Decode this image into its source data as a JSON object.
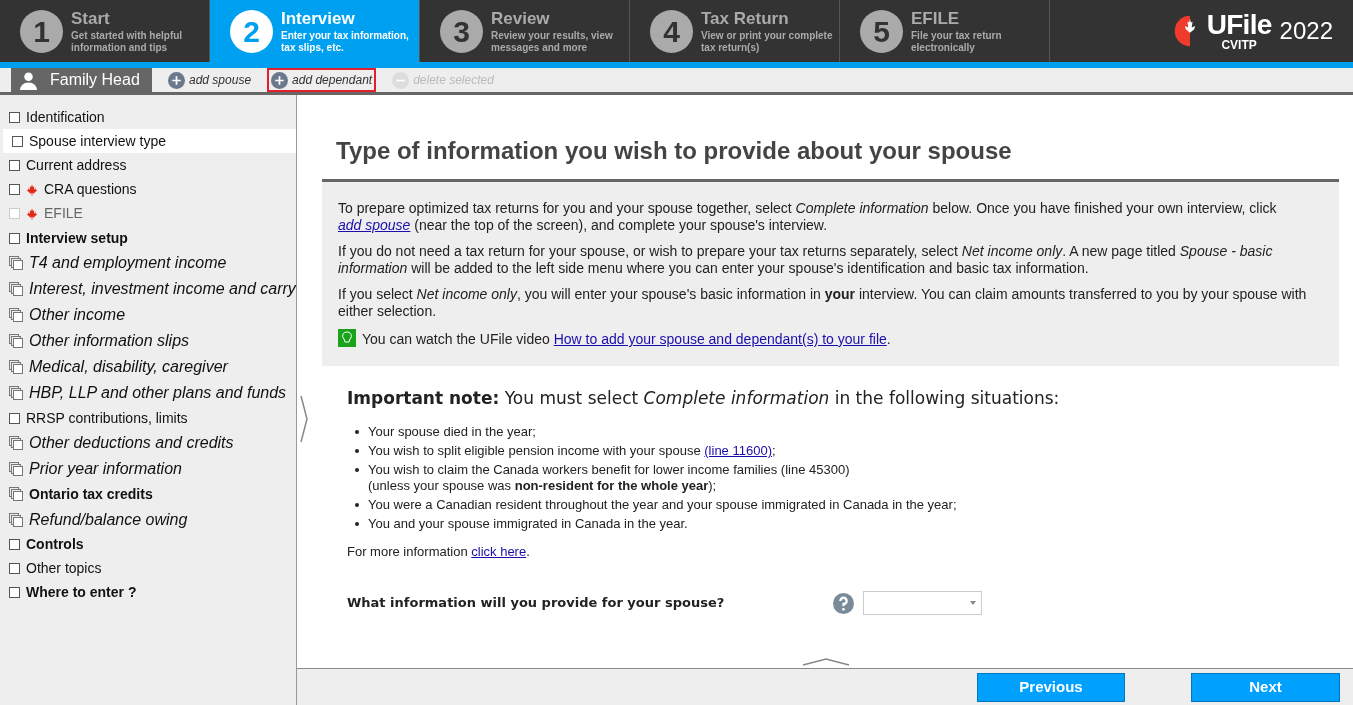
{
  "steps": [
    {
      "number": "1",
      "title": "Start",
      "subtitle": "Get started with helpful information and tips",
      "selected": false
    },
    {
      "number": "2",
      "title": "Interview",
      "subtitle": "Enter your tax information, tax slips, etc.",
      "selected": true
    },
    {
      "number": "3",
      "title": "Review",
      "subtitle": "Review your results, view messages and more",
      "selected": false
    },
    {
      "number": "4",
      "title": "Tax Return",
      "subtitle": "View or print your complete tax return(s)",
      "selected": false
    },
    {
      "number": "5",
      "title": "EFILE",
      "subtitle": "File your tax return electronically",
      "selected": false
    }
  ],
  "logo": {
    "name": "UFile",
    "sub": "CVITP",
    "year": "2022"
  },
  "toolbar": {
    "person_tab": "Family Head",
    "actions": [
      {
        "label": "add spouse",
        "kind": "add",
        "disabled": false,
        "highlighted": false
      },
      {
        "label": "add dependant",
        "kind": "add",
        "disabled": false,
        "highlighted": true
      },
      {
        "label": "delete selected",
        "kind": "delete",
        "disabled": true,
        "highlighted": false
      }
    ]
  },
  "sidebar": {
    "items": [
      {
        "label": "Identification",
        "kind": "page",
        "maple": false,
        "disabled": false,
        "selected": false
      },
      {
        "label": "Spouse interview type",
        "kind": "page",
        "maple": false,
        "disabled": false,
        "selected": true
      },
      {
        "label": "Current address",
        "kind": "page",
        "maple": false,
        "disabled": false,
        "selected": false
      },
      {
        "label": "CRA questions",
        "kind": "page",
        "maple": true,
        "disabled": false,
        "selected": false
      },
      {
        "label": "EFILE",
        "kind": "page",
        "maple": true,
        "disabled": true,
        "selected": false
      },
      {
        "label": "Interview setup",
        "kind": "section",
        "maple": false,
        "disabled": false,
        "selected": false
      },
      {
        "label": "T4 and employment income",
        "kind": "group",
        "maple": false,
        "disabled": false,
        "selected": false
      },
      {
        "label": "Interest, investment income and carry",
        "kind": "group",
        "maple": false,
        "disabled": false,
        "selected": false
      },
      {
        "label": "Other income",
        "kind": "group",
        "maple": false,
        "disabled": false,
        "selected": false
      },
      {
        "label": "Other information slips",
        "kind": "group",
        "maple": false,
        "disabled": false,
        "selected": false
      },
      {
        "label": "Medical, disability, caregiver",
        "kind": "group",
        "maple": false,
        "disabled": false,
        "selected": false
      },
      {
        "label": "HBP, LLP and other plans and funds",
        "kind": "group",
        "maple": false,
        "disabled": false,
        "selected": false
      },
      {
        "label": "RRSP contributions, limits",
        "kind": "page",
        "maple": false,
        "disabled": false,
        "selected": false
      },
      {
        "label": "Other deductions and credits",
        "kind": "group",
        "maple": false,
        "disabled": false,
        "selected": false
      },
      {
        "label": "Prior year information",
        "kind": "group",
        "maple": false,
        "disabled": false,
        "selected": false
      },
      {
        "label": "Ontario tax credits",
        "kind": "province",
        "maple": false,
        "disabled": false,
        "selected": false
      },
      {
        "label": "Refund/balance owing",
        "kind": "group",
        "maple": false,
        "disabled": false,
        "selected": false
      },
      {
        "label": "Controls",
        "kind": "section",
        "maple": false,
        "disabled": false,
        "selected": false
      },
      {
        "label": "Other topics",
        "kind": "page",
        "maple": false,
        "disabled": false,
        "selected": false
      },
      {
        "label": "Where to enter ?",
        "kind": "section",
        "maple": false,
        "disabled": false,
        "selected": false
      }
    ]
  },
  "content": {
    "title": "Type of information you wish to provide about your spouse",
    "info": [
      {
        "parts": [
          {
            "kind": "text",
            "text": "To prepare optimized tax returns for you and your spouse together, select *Complete information* below. Once you have finished your own interview, click "
          },
          {
            "kind": "emlink",
            "text": "add spouse"
          },
          {
            "kind": "text",
            "text": " (near the top of the screen), and complete your spouse's interview."
          }
        ]
      },
      {
        "parts": [
          {
            "kind": "text",
            "text": "If you do not need a tax return for your spouse, or wish to prepare your tax returns separately, select *Net income only*. A new page titled *Spouse - basic information* will be added to the left side menu where you can enter your spouse's identification and basic tax information."
          }
        ]
      },
      {
        "parts": [
          {
            "kind": "text",
            "text": "If you select *Net income only*, you will enter your spouse's basic information in **your** interview. You can claim amounts transferred to you by your spouse with either selection."
          }
        ]
      }
    ],
    "tip": {
      "parts": [
        {
          "kind": "text",
          "text": "You can watch the UFile video "
        },
        {
          "kind": "link",
          "text": "How to add your spouse and dependant(s) to your file"
        },
        {
          "kind": "text",
          "text": "."
        }
      ]
    },
    "note": "**Important note:** You must select *Complete information* in the following situations:",
    "bullets": [
      {
        "parts": [
          {
            "kind": "text",
            "text": "Your spouse died in the year;"
          }
        ]
      },
      {
        "parts": [
          {
            "kind": "text",
            "text": "You wish to split eligible pension income with your spouse "
          },
          {
            "kind": "link",
            "text": "(line 11600)"
          },
          {
            "kind": "text",
            "text": ";"
          }
        ]
      },
      {
        "parts": [
          {
            "kind": "text",
            "text": "You wish to claim the Canada workers benefit for lower income families (line 45300)"
          },
          {
            "kind": "break"
          },
          {
            "kind": "text",
            "text": "(unless your spouse was **non-resident for the whole year**);"
          }
        ]
      },
      {
        "parts": [
          {
            "kind": "text",
            "text": "You were a Canadian resident throughout the year and your spouse immigrated in Canada in the year;"
          }
        ]
      },
      {
        "parts": [
          {
            "kind": "text",
            "text": "You and your spouse immigrated in Canada in the year."
          }
        ]
      }
    ],
    "more": {
      "parts": [
        {
          "kind": "text",
          "text": "For more information "
        },
        {
          "kind": "link",
          "text": "click here"
        },
        {
          "kind": "text",
          "text": "."
        }
      ]
    },
    "question": "What information will you provide for your spouse?"
  },
  "footer": {
    "previous": "Previous",
    "next": "Next"
  }
}
